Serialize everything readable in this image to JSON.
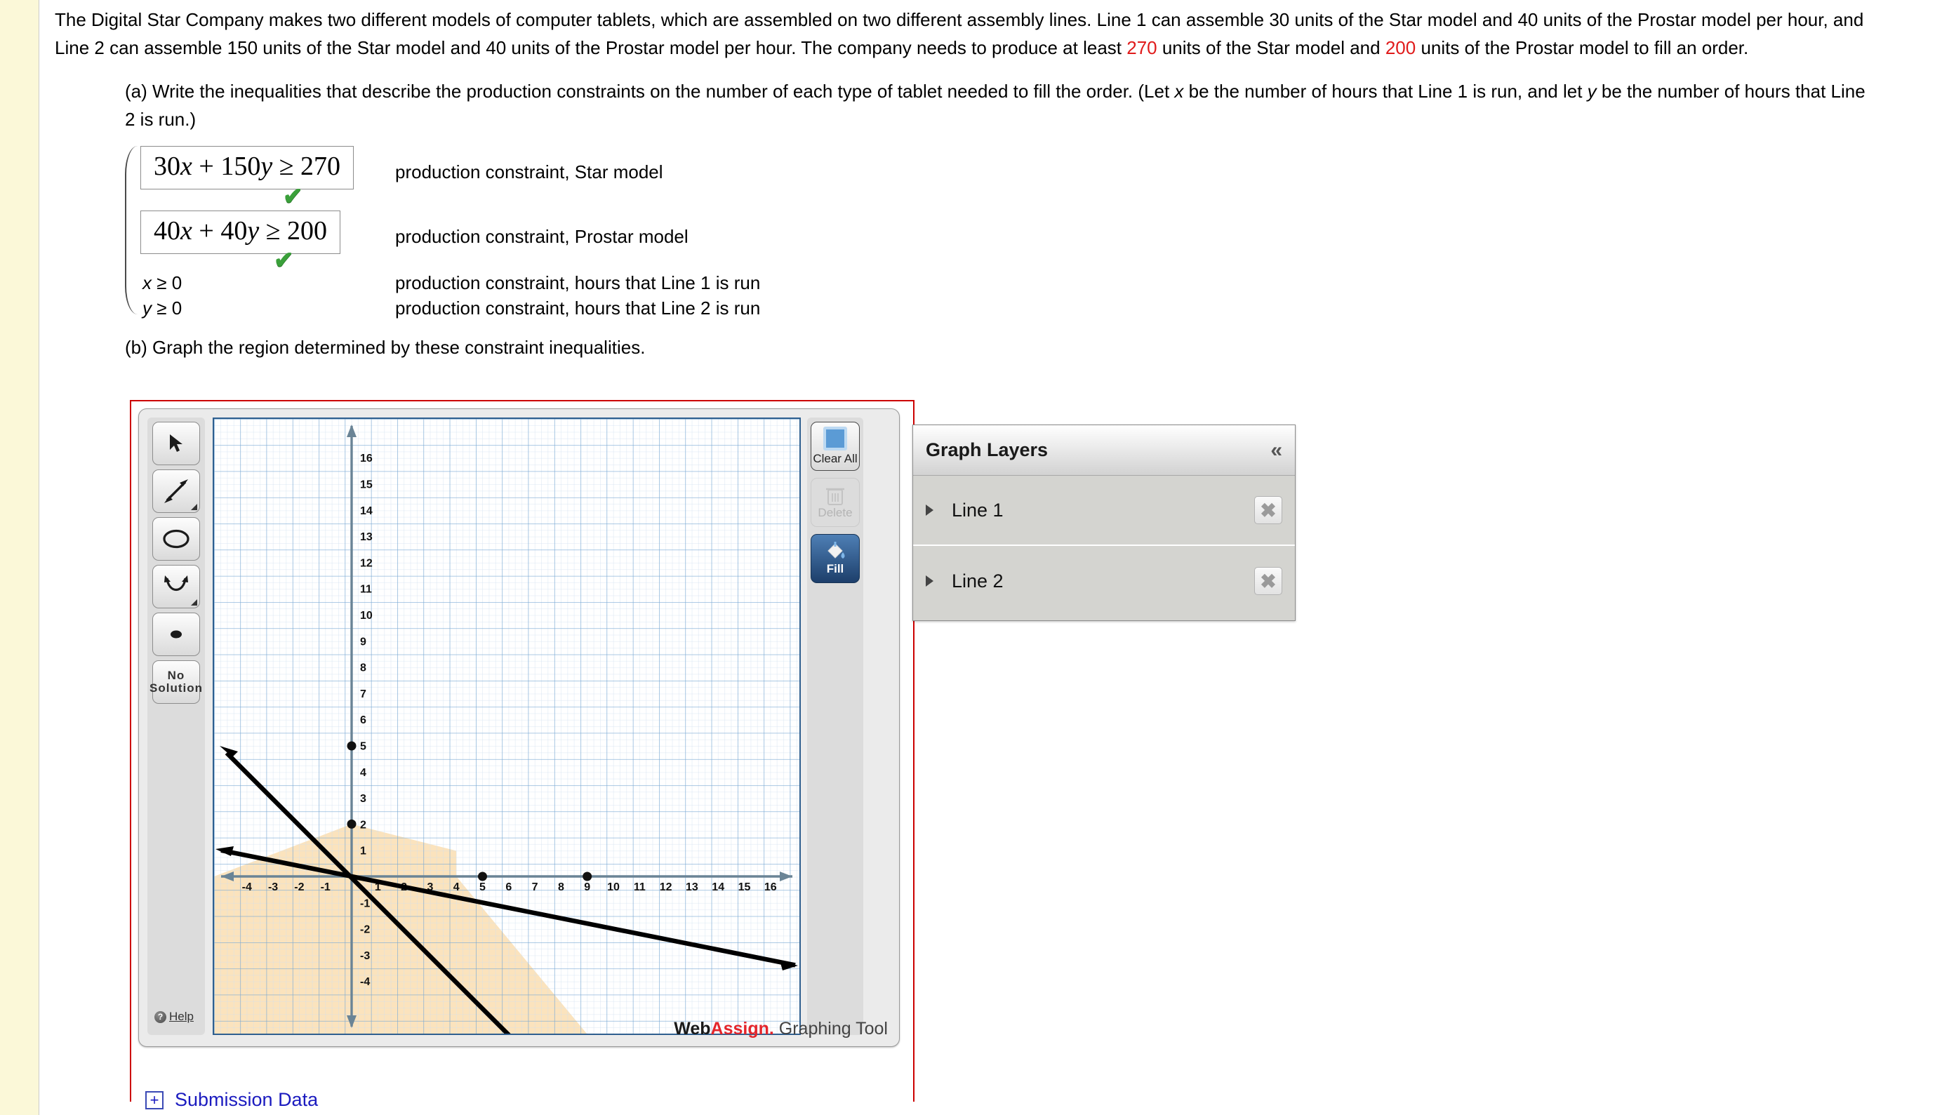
{
  "problem": {
    "paragraph_parts": [
      {
        "t": "The Digital Star Company makes two different models of computer tablets, which are assembled on two different assembly lines. Line 1 can assemble 30 units of the Star model and 40 units of the Prostar model per hour, and Line 2 can assemble 150 units of the Star model and 40 units of the Prostar model per hour. The company needs to produce at least ",
        "c": "black"
      },
      {
        "t": "270",
        "c": "red"
      },
      {
        "t": " units of the Star model and ",
        "c": "black"
      },
      {
        "t": "200",
        "c": "red"
      },
      {
        "t": " units of the Prostar model to fill an order.",
        "c": "black"
      }
    ],
    "part_a_text_1": "(a) Write the inequalities that describe the production constraints on the number of each type of tablet needed to fill the order. (Let ",
    "part_a_var_x": "x",
    "part_a_text_2": " be the number of hours that Line 1 is run, and let ",
    "part_a_var_y": "y",
    "part_a_text_3": " be the number of hours that Line 2 is run.)",
    "part_b_text": "(b) Graph the region determined by these constraint inequalities."
  },
  "answers": [
    {
      "id": "star",
      "boxed": true,
      "expr_lhs_num1": "30",
      "expr_var1": "x",
      "expr_plus": " + ",
      "expr_lhs_num2": "150",
      "expr_var2": "y",
      "expr_rel": " ≥ ",
      "expr_rhs": "270",
      "expr_full": "30x + 150y ≥ 270",
      "status_icon": "check-mark",
      "status": "correct",
      "label": "production constraint, Star model"
    },
    {
      "id": "prostar",
      "boxed": true,
      "expr_lhs_num1": "40",
      "expr_var1": "x",
      "expr_plus": " + ",
      "expr_lhs_num2": "40",
      "expr_var2": "y",
      "expr_rel": " ≥ ",
      "expr_rhs": "200",
      "expr_full": "40x + 40y ≥ 200",
      "status_icon": "check-mark",
      "status": "correct",
      "label": "production constraint, Prostar model"
    },
    {
      "id": "x-nonneg",
      "boxed": false,
      "expr_full": "x ≥ 0",
      "label": "production constraint, hours that Line 1 is run"
    },
    {
      "id": "y-nonneg",
      "boxed": false,
      "expr_full": "y ≥ 0",
      "label": "production constraint, hours that Line 2 is run"
    }
  ],
  "graphing_tool": {
    "left_tools": [
      {
        "name": "select-tool",
        "icon": "cursor-arrow-icon",
        "has_corner": false
      },
      {
        "name": "line-tool",
        "icon": "double-arrow-line-icon",
        "has_corner": true
      },
      {
        "name": "circle-tool",
        "icon": "ellipse-icon",
        "has_corner": false
      },
      {
        "name": "parabola-tool",
        "icon": "parabola-icon",
        "has_corner": true
      },
      {
        "name": "point-tool",
        "icon": "filled-dot-icon",
        "has_corner": false
      },
      {
        "name": "no-solution-tool",
        "icon": "text-icon",
        "label": "No\nSolution",
        "label_line1": "No",
        "label_line2": "Solution",
        "has_corner": false
      }
    ],
    "help_label": "Help",
    "right_tools": [
      {
        "name": "clear-all-button",
        "label": "Clear All",
        "icon": "square-icon",
        "enabled": true
      },
      {
        "name": "delete-button",
        "label": "Delete",
        "icon": "trash-can-icon",
        "enabled": false
      },
      {
        "name": "fill-button",
        "label": "Fill",
        "icon": "paint-bucket-icon",
        "enabled": true,
        "active": true
      }
    ],
    "branding": {
      "part1": "Web",
      "part2": "Assign.",
      "part3": " Graphing Tool"
    }
  },
  "layers_panel": {
    "title": "Graph Layers",
    "collapse_icon": "double-chevron-left-icon",
    "items": [
      {
        "label": "Line 1",
        "expand_icon": "triangle-right-icon",
        "remove_icon": "x-close-icon"
      },
      {
        "label": "Line 2",
        "expand_icon": "triangle-right-icon",
        "remove_icon": "x-close-icon"
      }
    ]
  },
  "submission": {
    "expand_icon": "plus-box-icon",
    "label": "Submission Data"
  },
  "chart_data": {
    "type": "line",
    "title": "",
    "xlabel": "",
    "ylabel": "",
    "xlim": [
      -5.5,
      17.5
    ],
    "ylim": [
      -5.5,
      17.5
    ],
    "x_ticks": [
      -4,
      -3,
      -2,
      -1,
      1,
      2,
      3,
      4,
      5,
      6,
      7,
      8,
      9,
      10,
      11,
      12,
      13,
      14,
      15,
      16
    ],
    "y_ticks": [
      -4,
      -3,
      -2,
      -1,
      1,
      2,
      3,
      4,
      5,
      6,
      7,
      8,
      9,
      10,
      11,
      12,
      13,
      14,
      15,
      16
    ],
    "grid": true,
    "minor_grid": true,
    "grid_color": "#9dc3e6",
    "axis_color": "#6a8496",
    "curve_color": "#000000",
    "fill_color": "#fbe3bd",
    "series": [
      {
        "name": "Line 1",
        "equation": "40x + 40y = 200",
        "style": "solid-double-arrow",
        "points": [
          [
            0,
            5
          ],
          [
            5,
            0
          ]
        ],
        "slope": -1,
        "y_intercept": 5,
        "x_intercept": 5,
        "markers": [
          [
            0,
            5
          ],
          [
            5,
            0
          ]
        ]
      },
      {
        "name": "Line 2",
        "equation": "30x + 150y = 270",
        "style": "solid-double-arrow",
        "points": [
          [
            0,
            2
          ],
          [
            9,
            0
          ]
        ],
        "slope": -0.2,
        "y_intercept": 2,
        "x_intercept": 9,
        "markers": [
          [
            0,
            2
          ],
          [
            9,
            0
          ]
        ]
      }
    ],
    "shaded_region": {
      "description": "region below both lines",
      "fill": "#fbe3bd"
    }
  }
}
